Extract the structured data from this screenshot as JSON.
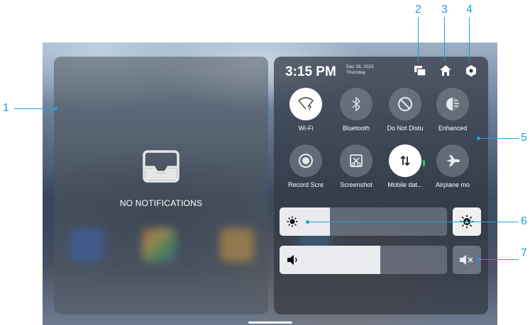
{
  "callouts": [
    "1",
    "2",
    "3",
    "4",
    "5",
    "6",
    "7"
  ],
  "notifications": {
    "empty_text": "NO NOTIFICATIONS"
  },
  "header": {
    "time": "3:15 PM",
    "date": "Dec 28, 2023",
    "weekday": "Thursday"
  },
  "tiles": [
    {
      "label": "Wi-Fi",
      "icon": "wifi-unknown-icon",
      "on": true
    },
    {
      "label": "Bluetooth",
      "icon": "bluetooth-icon",
      "on": false
    },
    {
      "label": "Do Not Distu",
      "icon": "do-not-disturb-icon",
      "on": false
    },
    {
      "label": "Enhanced",
      "icon": "enhanced-icon",
      "on": false
    },
    {
      "label": "Record Scre",
      "icon": "record-screen-icon",
      "on": false
    },
    {
      "label": "Screenshot",
      "icon": "screenshot-icon",
      "on": false
    },
    {
      "label": "Mobile dat...",
      "icon": "mobile-data-icon",
      "on": true
    },
    {
      "label": "Airplane mo",
      "icon": "airplane-icon",
      "on": false
    }
  ],
  "brightness": {
    "level": 0.3,
    "icon": "brightness-icon",
    "auto_icon": "auto-brightness-icon"
  },
  "volume": {
    "level": 0.6,
    "icon": "volume-icon",
    "mute_icon": "mute-icon"
  },
  "colors": {
    "callout": "#1aa4d9",
    "tile_on": "#ffffff",
    "tile_off": "#828a96"
  }
}
